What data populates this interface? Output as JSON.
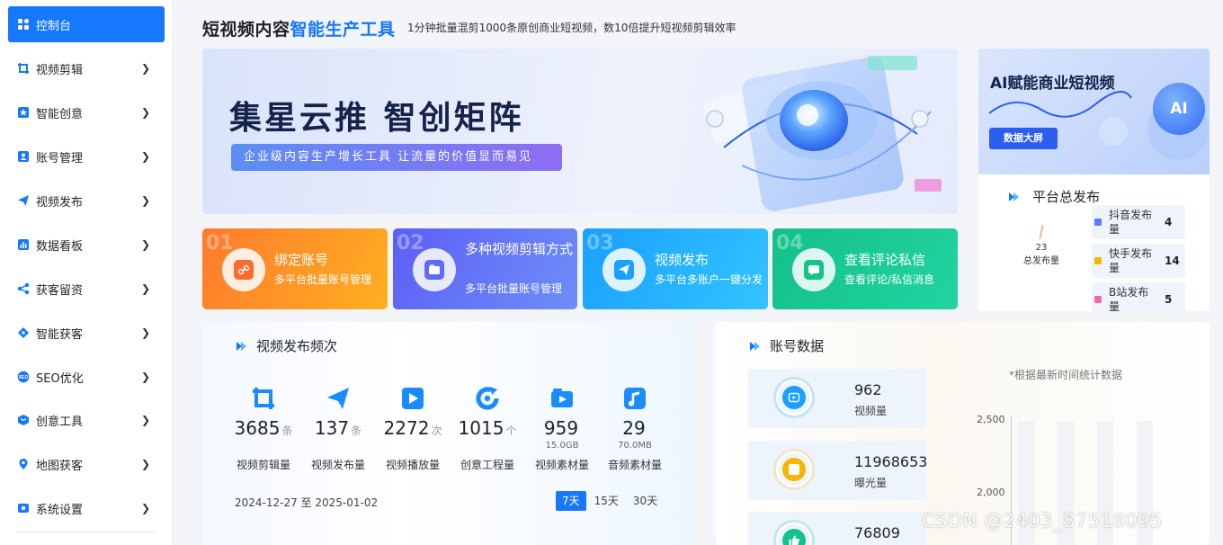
{
  "sidebar": {
    "items": [
      {
        "label": "控制台",
        "icon": "dashboard-icon",
        "active": true
      },
      {
        "label": "视频剪辑",
        "icon": "crop-icon"
      },
      {
        "label": "智能创意",
        "icon": "star-icon"
      },
      {
        "label": "账号管理",
        "icon": "user-card-icon"
      },
      {
        "label": "视频发布",
        "icon": "paper-plane-icon"
      },
      {
        "label": "数据看板",
        "icon": "bar-chart-icon"
      },
      {
        "label": "获客留资",
        "icon": "share-icon"
      },
      {
        "label": "智能获客",
        "icon": "network-icon"
      },
      {
        "label": "SEO优化",
        "icon": "seo-icon"
      },
      {
        "label": "创意工具",
        "icon": "cube-icon"
      },
      {
        "label": "地图获客",
        "icon": "map-pin-icon"
      },
      {
        "label": "系统设置",
        "icon": "settings-icon"
      }
    ]
  },
  "header": {
    "title_part1": "短视频内容",
    "title_highlight": "智能生产工具",
    "subtitle": "1分钟批量混剪1000条原创商业短视频，数10倍提升短视频剪辑效率"
  },
  "hero": {
    "title": "集星云推  智创矩阵",
    "tagline": "企业级内容生产增长工具  让流量的价值显而易见"
  },
  "promo": {
    "title": "AI赋能商业短视频",
    "button": "数据大屏",
    "badge": "AI",
    "section_title": "平台总发布",
    "total_value": "23",
    "total_label": "总发布量",
    "platforms": [
      {
        "name": "抖音发布量",
        "value": "4",
        "color": "#5b7cf7"
      },
      {
        "name": "快手发布量",
        "value": "14",
        "color": "#f7b500"
      },
      {
        "name": "B站发布量",
        "value": "5",
        "color": "#f06ba6"
      }
    ]
  },
  "feature_cards": [
    {
      "num": "01",
      "title": "绑定账号",
      "sub": "多平台批量账号管理",
      "icon": "link-icon",
      "icon_color": "#ff6b2c"
    },
    {
      "num": "02",
      "title": "多种视频剪辑方式",
      "sub": "多平台批量账号管理",
      "icon": "video-folder-icon",
      "icon_color": "#5b6cf7"
    },
    {
      "num": "03",
      "title": "视频发布",
      "sub": "多平台多账户一键分发",
      "icon": "paper-plane-icon",
      "icon_color": "#1aa0ff"
    },
    {
      "num": "04",
      "title": "查看评论私信",
      "sub": "查看评论/私信消息",
      "icon": "comment-icon",
      "icon_color": "#13c48a"
    }
  ],
  "video_stats": {
    "title": "视频发布频次",
    "items": [
      {
        "value": "3685",
        "unit": "条",
        "sub": "",
        "label": "视频剪辑量",
        "icon": "crop-icon"
      },
      {
        "value": "137",
        "unit": "条",
        "sub": "",
        "label": "视频发布量",
        "icon": "paper-plane-icon"
      },
      {
        "value": "2272",
        "unit": "次",
        "sub": "",
        "label": "视频播放量",
        "icon": "play-icon"
      },
      {
        "value": "1015",
        "unit": "个",
        "sub": "",
        "label": "创意工程量",
        "icon": "refresh-icon"
      },
      {
        "value": "959",
        "unit": "",
        "sub": "15.0GB",
        "label": "视频素材量",
        "icon": "video-folder-icon"
      },
      {
        "value": "29",
        "unit": "",
        "sub": "70.0MB",
        "label": "音频素材量",
        "icon": "music-icon"
      }
    ],
    "date_range": "2024-12-27 至 2025-01-02",
    "ranges": [
      "7天",
      "15天",
      "30天"
    ],
    "active_range": "7天"
  },
  "account_data": {
    "title": "账号数据",
    "note": "*根据最新时间统计数据",
    "metrics": [
      {
        "value": "962",
        "label": "视频量",
        "icon": "video-icon",
        "color": "#1aa0ff"
      },
      {
        "value": "11968653",
        "label": "曝光量",
        "icon": "star-icon",
        "color": "#f7b500"
      },
      {
        "value": "76809",
        "label": "",
        "icon": "thumbs-up-icon",
        "color": "#13c48a"
      }
    ],
    "chart_ticks": [
      "2,500",
      "2,000"
    ]
  },
  "watermark": "CSDN @2403_87518095"
}
